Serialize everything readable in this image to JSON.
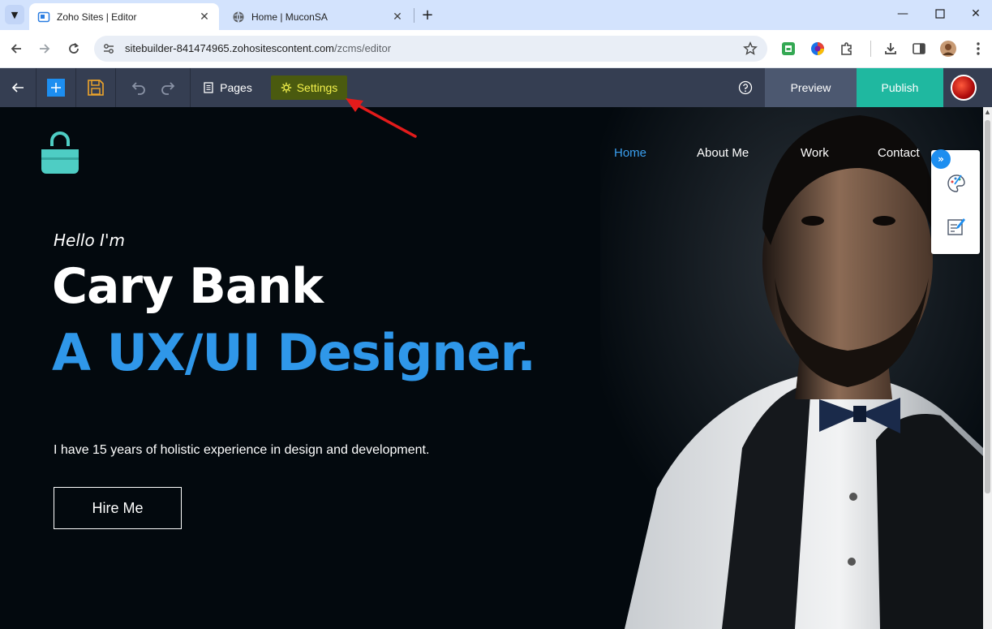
{
  "browser": {
    "tabs": [
      {
        "title": "Zoho Sites | Editor",
        "active": true
      },
      {
        "title": "Home | MuconSA",
        "active": false
      }
    ],
    "url_host": "sitebuilder-841474965.zohositescontent.com",
    "url_path": "/zcms/editor"
  },
  "editor": {
    "pages_label": "Pages",
    "settings_label": "Settings",
    "preview_label": "Preview",
    "publish_label": "Publish",
    "settings_highlight_color": "#4a5a0f",
    "publish_color": "#1fb8a0"
  },
  "site": {
    "nav": [
      {
        "label": "Home",
        "active": true
      },
      {
        "label": "About Me",
        "active": false
      },
      {
        "label": "Work",
        "active": false
      },
      {
        "label": "Contact",
        "active": false
      }
    ],
    "greeting": "Hello I'm",
    "name": "Cary Bank",
    "role": "A UX/UI Designer.",
    "description": "I have 15 years of holistic experience in design and development.",
    "cta_label": "Hire Me",
    "accent_color": "#2f97e9",
    "logo_icon": "shopping-bag-icon"
  },
  "side_panel": {
    "icons": [
      "expand-icon",
      "palette-icon",
      "edit-note-icon"
    ]
  }
}
